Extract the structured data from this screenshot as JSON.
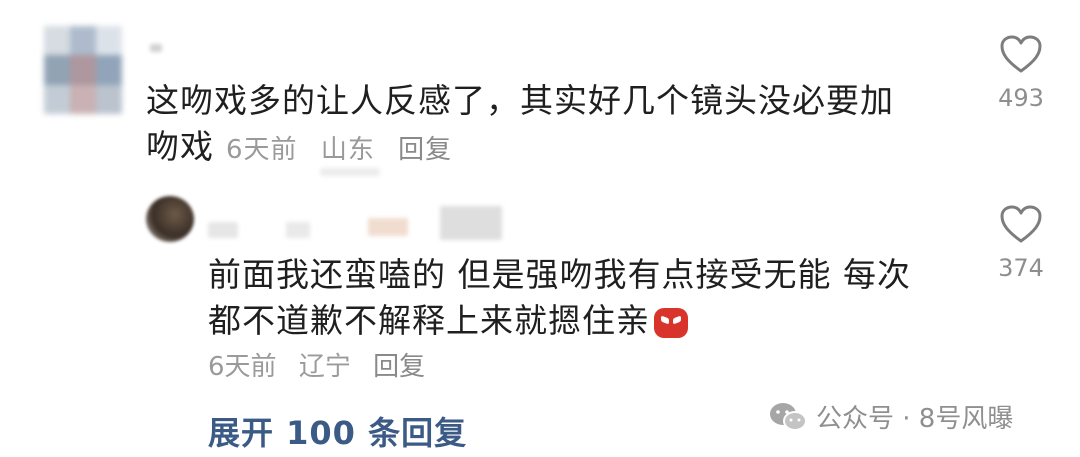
{
  "comment": {
    "text_line1": "这吻戏多的让人反感了，其实好几个镜头没必要加",
    "text_line2": "吻戏",
    "time": "6天前",
    "location": "山东",
    "reply_label": "回复",
    "likes": "493"
  },
  "reply": {
    "text_line1": "前面我还蛮嗑的 但是强吻我有点接受无能 每次",
    "text_line2": "都不道歉不解释上来就摁住亲",
    "emoji": "angry-face-emoji",
    "time": "6天前",
    "location": "辽宁",
    "reply_label": "回复",
    "likes": "374"
  },
  "expand_label": "展开 100 条回复",
  "watermark": {
    "text": "公众号 · 8号风曝",
    "icon": "wechat-icon"
  },
  "colors": {
    "text": "#1f1f1f",
    "meta": "#9a9a9a",
    "link": "#3b5a86"
  }
}
